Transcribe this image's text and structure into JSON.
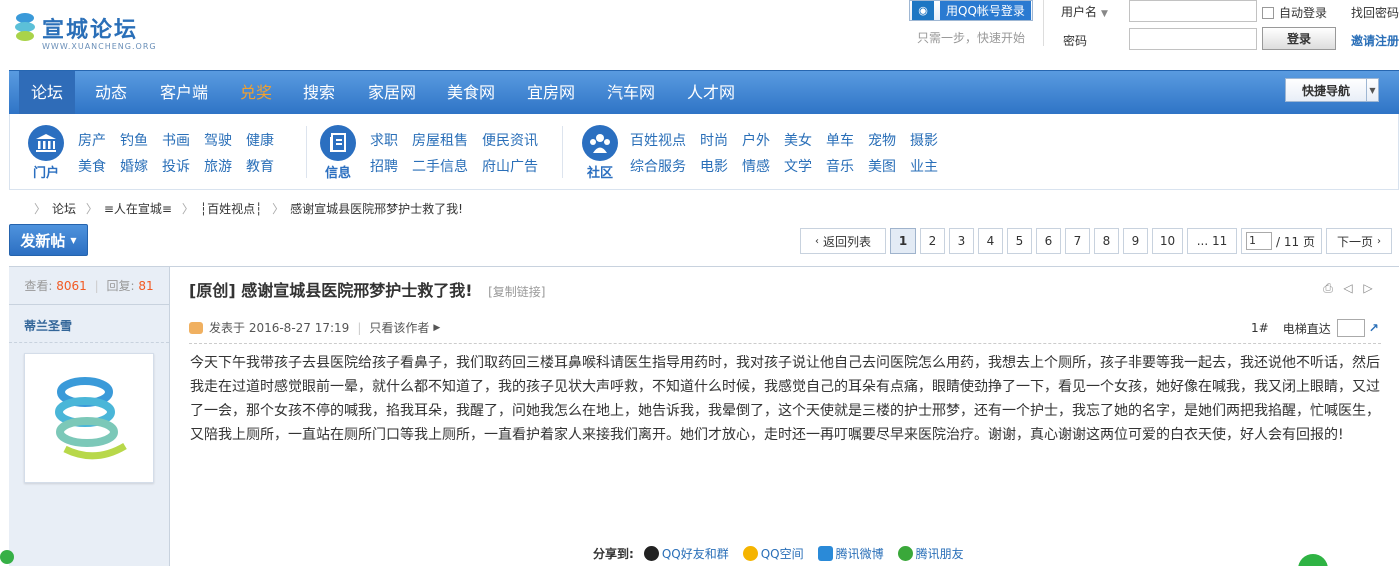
{
  "header": {
    "logo_text": "宣城论坛",
    "logo_sub": "WWW.XUANCHENG.ORG",
    "qq_login": "用QQ帐号登录",
    "qq_hint": "只需一步，快速开始",
    "username_label": "用户名",
    "password_label": "密码",
    "auto_login": "自动登录",
    "login_button": "登录",
    "find_password": "找回密码",
    "invite_register": "邀请注册"
  },
  "nav": {
    "items": [
      "论坛",
      "动态",
      "客户端",
      "兑奖",
      "搜索",
      "家居网",
      "美食网",
      "宜房网",
      "汽车网",
      "人才网"
    ],
    "quick_nav": "快捷导航"
  },
  "categories": {
    "portal": {
      "label": "门户",
      "row1": [
        "房产",
        "钓鱼",
        "书画",
        "驾驶",
        "健康"
      ],
      "row2": [
        "美食",
        "婚嫁",
        "投诉",
        "旅游",
        "教育"
      ]
    },
    "info": {
      "label": "信息",
      "row1": [
        "求职",
        "房屋租售",
        "便民资讯"
      ],
      "row2": [
        "招聘",
        "二手信息",
        "府山广告"
      ]
    },
    "community": {
      "label": "社区",
      "row1": [
        "百姓视点",
        "时尚",
        "户外",
        "美女",
        "单车",
        "宠物",
        "摄影"
      ],
      "row2": [
        "综合服务",
        "电影",
        "情感",
        "文学",
        "音乐",
        "美图",
        "业主"
      ]
    }
  },
  "breadcrumb": [
    "论坛",
    "≡人在宣城≡",
    "┆百姓视点┆",
    "感谢宣城县医院邢梦护士救了我!"
  ],
  "toolbar": {
    "post_button": "发新帖",
    "back_list": "返回列表",
    "pages": [
      "1",
      "2",
      "3",
      "4",
      "5",
      "6",
      "7",
      "8",
      "9",
      "10",
      "... 11"
    ],
    "current_page": "1",
    "page_input": "1",
    "page_total": "/ 11 页",
    "next": "下一页"
  },
  "post": {
    "views_label": "查看:",
    "views": "8061",
    "replies_label": "回复:",
    "replies": "81",
    "author": "蒂兰圣雪",
    "title_tag": "[原创]",
    "title": "感谢宣城县医院邢梦护士救了我!",
    "copy_link": "[复制链接]",
    "posted": "发表于 2016-8-27 17:19",
    "only_author": "只看该作者",
    "floor": "1#",
    "jump_label": "电梯直达",
    "body": "今天下午我带孩子去县医院给孩子看鼻子，我们取药回三楼耳鼻喉科请医生指导用药时，我对孩子说让他自己去问医院怎么用药，我想去上个厕所，孩子非要等我一起去，我还说他不听话，然后我走在过道时感觉眼前一晕，就什么都不知道了，我的孩子见状大声呼救，不知道什么时候，我感觉自己的耳朵有点痛，眼睛使劲挣了一下，看见一个女孩，她好像在喊我，我又闭上眼睛，又过了一会，那个女孩不停的喊我，掐我耳朵，我醒了，问她我怎么在地上，她告诉我，我晕倒了，这个天使就是三楼的护士邢梦，还有一个护士，我忘了她的名字，是她们两把我掐醒，忙喊医生，又陪我上厕所，一直站在厕所门口等我上厕所，一直看护着家人来接我们离开。她们才放心，走时还一再叮嘱要尽早来医院治疗。谢谢，真心谢谢这两位可爱的白衣天使，好人会有回报的!",
    "share_label": "分享到:",
    "share": [
      "QQ好友和群",
      "QQ空间",
      "腾讯微博",
      "腾讯朋友"
    ]
  },
  "colors": {
    "nav_blue": "#2f74c6",
    "link_blue": "#2a6fb8",
    "accent_orange": "#f25a23"
  }
}
